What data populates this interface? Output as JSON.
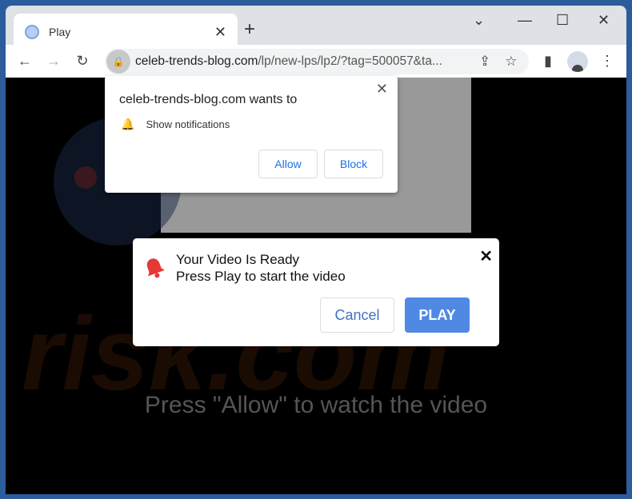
{
  "tab": {
    "title": "Play",
    "close": "✕",
    "new_tab": "+"
  },
  "window_controls": {
    "dropdown": "⌄",
    "minimize": "—",
    "maximize": "☐",
    "close": "✕"
  },
  "toolbar": {
    "back": "←",
    "forward": "→",
    "reload": "↻",
    "url_domain": "celeb-trends-blog.com",
    "url_path": "/lp/new-lps/lp2/?tag=500057&ta...",
    "share": "⇪",
    "bookmark": "☆",
    "sidepanel": "▮",
    "menu": "⋮"
  },
  "permission_prompt": {
    "heading": "celeb-trends-blog.com wants to",
    "item": "Show notifications",
    "allow": "Allow",
    "block": "Block",
    "close": "✕"
  },
  "dialog": {
    "line1": "Your Video Is Ready",
    "line2": "Press Play to start the video",
    "cancel": "Cancel",
    "play": "PLAY",
    "close": "✕"
  },
  "page": {
    "message": "Press \"Allow\" to watch the video"
  },
  "watermark": "PCrisk.com",
  "colors": {
    "accent": "#5089e4",
    "bell": "#e53935",
    "frame": "#2b5c9c"
  }
}
